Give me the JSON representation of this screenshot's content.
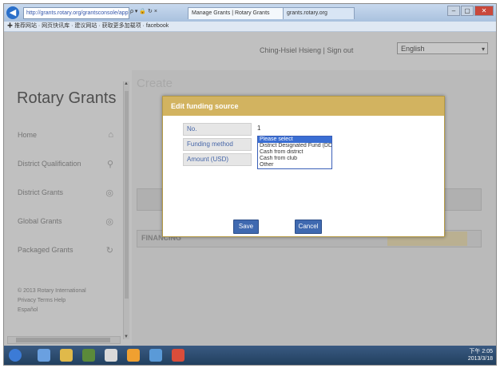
{
  "browser": {
    "address": "http://grants.rotary.org/grantsconsole/app",
    "address_tools": "ρ ▾ 🔒 ↻ ×",
    "tabs": [
      "Manage Grants | Rotary Grants",
      "grants.rotary.org"
    ],
    "favorites": "✚ 推荐网站 · 网页快讯库 · 建议网站 · 获取更多加载项 · facebook",
    "min": "–",
    "max": "▢",
    "close": "✕"
  },
  "header": {
    "user_links": "Ching-Hsiel Hsieng | Sign out",
    "language": "English",
    "language_chevron": "▾"
  },
  "sidebar": {
    "brand": "Rotary Grants",
    "items": [
      {
        "label": "Home",
        "icon": "home-icon",
        "glyph": "⌂"
      },
      {
        "label": "District Qualification",
        "icon": "pin-icon",
        "glyph": "⚲"
      },
      {
        "label": "District Grants",
        "icon": "globe-icon",
        "glyph": "◎"
      },
      {
        "label": "Global Grants",
        "icon": "globe-icon",
        "glyph": "◎"
      },
      {
        "label": "Packaged Grants",
        "icon": "refresh-icon",
        "glyph": "↻"
      }
    ],
    "footer_copyright": "© 2013 Rotary International",
    "footer_links": "Privacy  Terms  Help",
    "footer_more": "Español"
  },
  "main": {
    "page_heading": "Create",
    "financing_label": "FINANCING"
  },
  "modal": {
    "title": "Edit funding source",
    "fields": [
      {
        "label": "No.",
        "value": "1"
      },
      {
        "label": "Funding method",
        "value": ""
      },
      {
        "label": "Amount (USD)",
        "value": ""
      }
    ],
    "dropdown_options": [
      "Please select",
      "District Designated Fund (DDF)",
      "Cash from district",
      "Cash from club",
      "Other"
    ],
    "dropdown_selected_index": 0,
    "save_label": "Save",
    "cancel_label": "Cancel"
  },
  "taskbar": {
    "time": "下午 2:05",
    "date": "2013/3/18"
  },
  "colors": {
    "modal_header": "#d2b360",
    "button": "#3f69b0",
    "selection": "#3a6ed3"
  }
}
